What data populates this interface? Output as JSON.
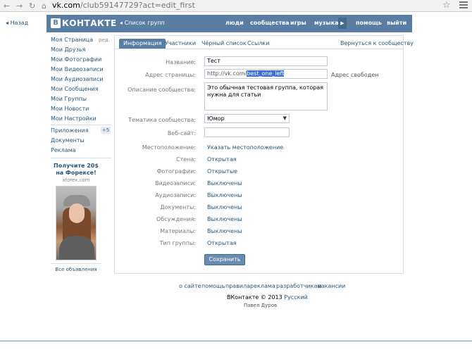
{
  "browser": {
    "url_host": "vk.com",
    "url_path": "/club59147729?act=edit_first"
  },
  "back_label": "Назад",
  "header": {
    "logo_letter": "В",
    "logo_text": "КОНТАКТЕ",
    "group_list": "Список групп",
    "nav": [
      "люди",
      "сообщества",
      "игры",
      "музыка",
      "помощь",
      "выйти"
    ]
  },
  "sidebar": {
    "edit_label": "ред.",
    "items": [
      "Моя Страница",
      "Мои Друзья",
      "Мои Фотографии",
      "Мои Видеозаписи",
      "Мои Аудиозаписи",
      "Мои Сообщения",
      "Мои Группы",
      "Мои Новости",
      "Мои Настройки"
    ],
    "extra": [
      "Приложения",
      "Документы",
      "Реклама"
    ],
    "apps_badge": "+5"
  },
  "ad": {
    "title": "Получите 20$ на Форексе!",
    "site": "xforex.com",
    "all": "Все объявления"
  },
  "tabs": [
    "Информация",
    "Участники",
    "Чёрный список",
    "Ссылки"
  ],
  "tab_back": "Вернуться к сообществу",
  "form": {
    "name_label": "Название:",
    "name_value": "Тест",
    "address_label": "Адрес страницы:",
    "address_prefix": "http://vk.com/",
    "address_value": "best_one_left",
    "address_status": "Адрес свободен",
    "desc_label": "Описание сообщества:",
    "desc_value": "Это обычная тестовая группа, которая нужна для статьи",
    "topic_label": "Тематика сообщества:",
    "topic_value": "Юмор",
    "website_label": "Веб-сайт:",
    "website_value": "",
    "location_label": "Местоположение:",
    "location_value": "Указать местоположение",
    "settings": [
      {
        "label": "Стена:",
        "value": "Открытая"
      },
      {
        "label": "Фотографии:",
        "value": "Открытые"
      },
      {
        "label": "Видеозаписи:",
        "value": "Выключены"
      },
      {
        "label": "Аудиозаписи:",
        "value": "Выключены"
      },
      {
        "label": "Документы:",
        "value": "Выключены"
      },
      {
        "label": "Обсуждения:",
        "value": "Выключены"
      },
      {
        "label": "Материалы:",
        "value": "Выключены"
      },
      {
        "label": "Тип группы:",
        "value": "Открытая"
      }
    ],
    "save": "Сохранить"
  },
  "footer": {
    "links": [
      "о сайте",
      "помощь",
      "правила",
      "реклама",
      "разработчикам",
      "вакансии"
    ],
    "copyright": "ВКонтакте © 2013",
    "language": "Русский",
    "author": "Павел Дуров"
  }
}
